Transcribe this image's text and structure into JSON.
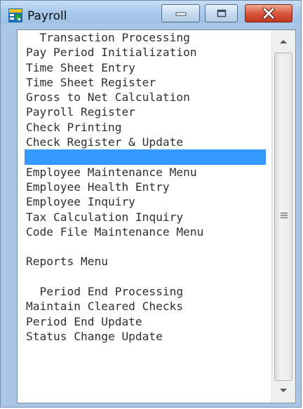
{
  "window": {
    "title": "Payroll",
    "icon": "payroll-app-icon",
    "controls": {
      "minimize_icon": "minimize-icon",
      "maximize_icon": "maximize-icon",
      "close_icon": "close-icon"
    }
  },
  "menu": {
    "items": [
      {
        "label": "  Transaction Processing",
        "type": "header"
      },
      {
        "label": "Pay Period Initialization",
        "type": "item"
      },
      {
        "label": "Time Sheet Entry",
        "type": "item"
      },
      {
        "label": "Time Sheet Register",
        "type": "item"
      },
      {
        "label": "Gross to Net Calculation",
        "type": "item"
      },
      {
        "label": "Payroll Register",
        "type": "item"
      },
      {
        "label": "Check Printing",
        "type": "item"
      },
      {
        "label": "Check Register & Update",
        "type": "item"
      },
      {
        "label": "",
        "type": "selected"
      },
      {
        "label": "Employee Maintenance Menu",
        "type": "item"
      },
      {
        "label": "Employee Health Entry",
        "type": "item"
      },
      {
        "label": "Employee Inquiry",
        "type": "item"
      },
      {
        "label": "Tax Calculation Inquiry",
        "type": "item"
      },
      {
        "label": "Code File Maintenance Menu",
        "type": "item"
      },
      {
        "label": "",
        "type": "blank"
      },
      {
        "label": "Reports Menu",
        "type": "item"
      },
      {
        "label": "",
        "type": "blank"
      },
      {
        "label": "  Period End Processing",
        "type": "header"
      },
      {
        "label": "Maintain Cleared Checks",
        "type": "item"
      },
      {
        "label": "Period End Update",
        "type": "item"
      },
      {
        "label": "Status Change Update",
        "type": "item"
      }
    ]
  },
  "scrollbar": {
    "up_icon": "scroll-up-arrow-icon",
    "down_icon": "scroll-down-arrow-icon",
    "grip_icon": "scroll-grip-icon"
  },
  "colors": {
    "selection": "#3399ff",
    "frame": "#a9c6e6",
    "close_button": "#d9553c"
  }
}
